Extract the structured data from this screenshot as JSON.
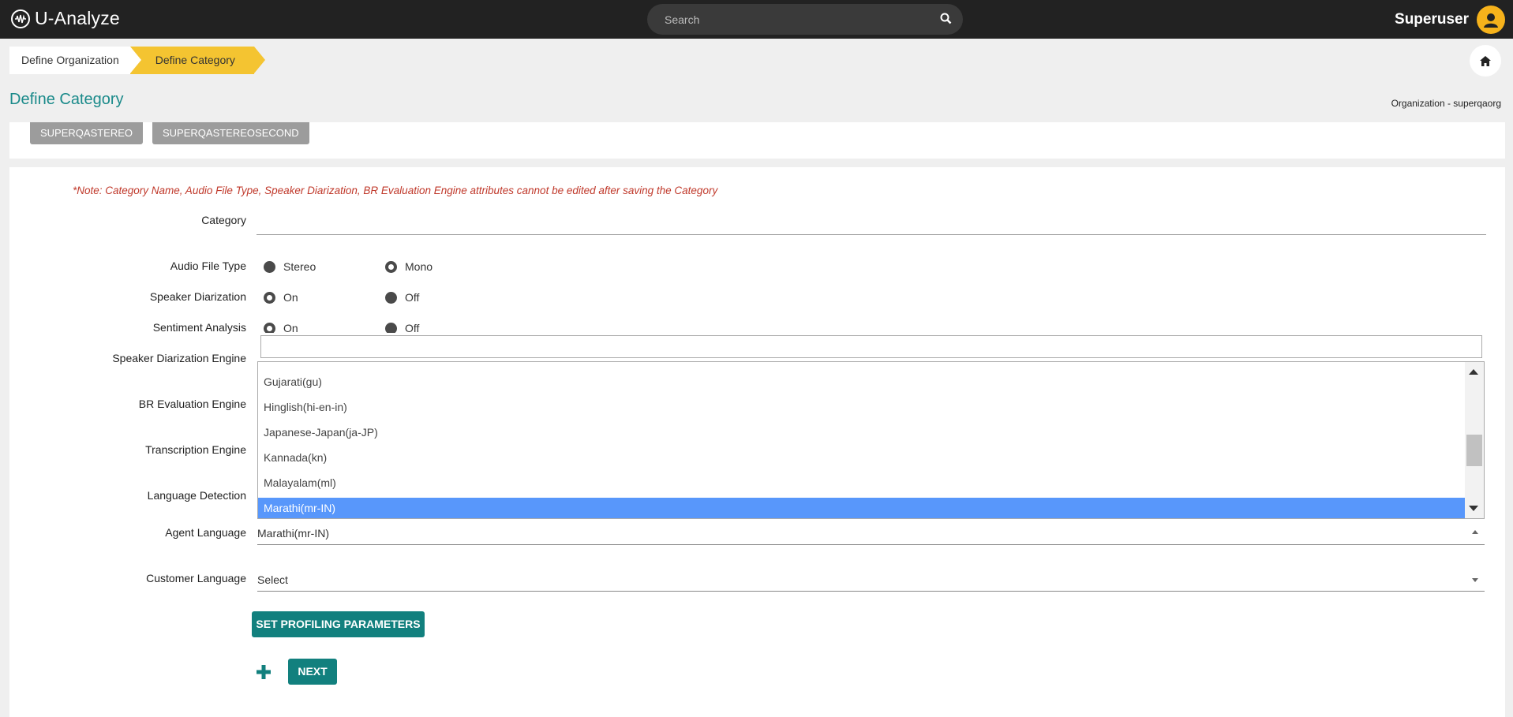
{
  "app": {
    "name": "U-Analyze"
  },
  "search": {
    "placeholder": "Search"
  },
  "user": {
    "name": "Superuser"
  },
  "breadcrumb": {
    "items": [
      "Define Organization",
      "Define Category"
    ]
  },
  "page": {
    "title": "Define Category",
    "org_label": "Organization - superqaorg"
  },
  "categories_chips": [
    "SUPERQASTEREO",
    "SUPERQASTEREOSECOND"
  ],
  "form": {
    "note": "*Note: Category Name, Audio File Type, Speaker Diarization, BR Evaluation Engine attributes cannot be edited after saving the Category",
    "labels": {
      "category": "Category",
      "audio_file_type": "Audio File Type",
      "speaker_diarization": "Speaker Diarization",
      "sentiment_analysis": "Sentiment Analysis",
      "speaker_diarization_engine": "Speaker Diarization Engine",
      "br_evaluation_engine": "BR Evaluation Engine",
      "transcription_engine": "Transcription Engine",
      "language_detection": "Language Detection",
      "agent_language": "Agent Language",
      "customer_language": "Customer Language"
    },
    "audio_file_type": {
      "options": [
        "Stereo",
        "Mono"
      ],
      "selected": "Mono"
    },
    "speaker_diarization": {
      "options": [
        "On",
        "Off"
      ],
      "selected": "On"
    },
    "sentiment_analysis": {
      "options": [
        "On",
        "Off"
      ],
      "selected": "On"
    },
    "agent_language": {
      "value": "Marathi(mr-IN)"
    },
    "customer_language": {
      "value": "Select"
    }
  },
  "dropdown": {
    "items": [
      "Gujarati(gu)",
      "Hinglish(hi-en-in)",
      "Japanese-Japan(ja-JP)",
      "Kannada(kn)",
      "Malayalam(ml)",
      "Marathi(mr-IN)"
    ],
    "selected": "Marathi(mr-IN)"
  },
  "buttons": {
    "profiling": "SET PROFILING PARAMETERS",
    "next": "NEXT"
  },
  "colors": {
    "accent": "#12807e",
    "title": "#1a8a8a",
    "crumb_active": "#f4c431",
    "selected_item": "#5897fb",
    "avatar": "#f6b21b"
  }
}
